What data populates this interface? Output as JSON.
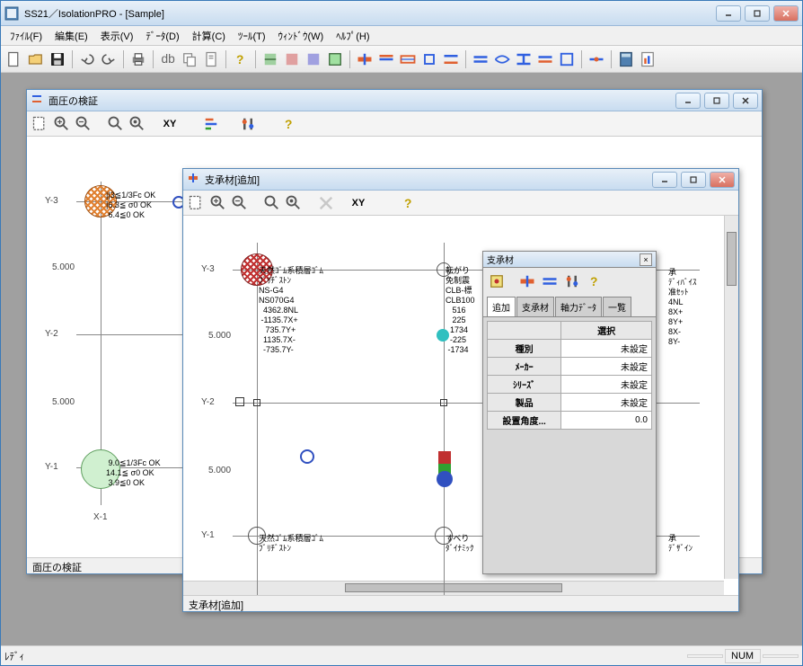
{
  "app": {
    "title": "SS21／IsolationPRO - [Sample]"
  },
  "menu": {
    "file": "ﾌｧｲﾙ(F)",
    "edit": "編集(E)",
    "view": "表示(V)",
    "data": "ﾃﾞｰﾀ(D)",
    "calc": "計算(C)",
    "tool": "ﾂｰﾙ(T)",
    "window": "ｳｨﾝﾄﾞｳ(W)",
    "help": "ﾍﾙﾌﾟ(H)"
  },
  "child1": {
    "title": "面圧の検証",
    "footer": "面圧の検証",
    "ylabels": [
      "Y-3",
      "Y-2",
      "Y-1"
    ],
    "xlabel": "X-1",
    "dim": "5.000",
    "node_y3": "||3≦1/3Fc OK\n|6.3≦ σ0 OK\n 6.4≦0 OK",
    "node_y1": " 9.0≦1/3Fc OK\n14.1≦ σ0 OK\n 3.9≦0 OK"
  },
  "child2": {
    "title": "支承材[追加]",
    "footer": "支承材[追加]",
    "ylabels": [
      "Y-3",
      "Y-2",
      "Y-1"
    ],
    "dim": "5.000",
    "node_y3": {
      "left": "天然ｺﾞﾑ系積層ｺﾞﾑ\nﾌﾞﾘﾁﾞｽﾄﾝ\nNS-G4\nNS070G4\n  4362.8NL\n -1135.7X+\n   735.7Y+\n  1135.7X-\n  -735.7Y-",
      "right": "転がり\n免制震\nCLB-標\nCLB100\n   516\n   225\n  1734\n  -225\n -1734"
    },
    "far_right": "承\nﾃﾞｨﾊﾞｲｽ\n准ｾｯﾄ\n4NL\n8X+\n8Y+\n8X-\n8Y-",
    "node_y1": {
      "left": "天然ｺﾞﾑ系積層ｺﾞﾑ\nﾌﾞﾘﾁﾞｽﾄﾝ",
      "right": "すべり\nﾀﾞｲﾅﾐｯｸ"
    },
    "far_right_y1": "承\nﾃﾞｻﾞｲﾝ"
  },
  "palette": {
    "title": "支承材",
    "tabs": {
      "add": "追加",
      "support": "支承材",
      "axial": "軸力ﾃﾞｰﾀ",
      "list": "一覧"
    },
    "grid": {
      "header": "選択",
      "rows": [
        {
          "label": "種別",
          "value": "未設定"
        },
        {
          "label": "ﾒｰｶｰ",
          "value": "未設定"
        },
        {
          "label": "ｼﾘｰｽﾞ",
          "value": "未設定"
        },
        {
          "label": "製品",
          "value": "未設定"
        },
        {
          "label": "設置角度...",
          "value": "0.0"
        }
      ]
    }
  },
  "status": {
    "ready": "ﾚﾃﾞｨ",
    "num": "NUM"
  },
  "colors": {
    "accent": "#3a7ab8",
    "red": "#c03030",
    "blue": "#3050c0",
    "green": "#30a030",
    "cyan": "#30c0c0",
    "orange": "#e08030"
  }
}
